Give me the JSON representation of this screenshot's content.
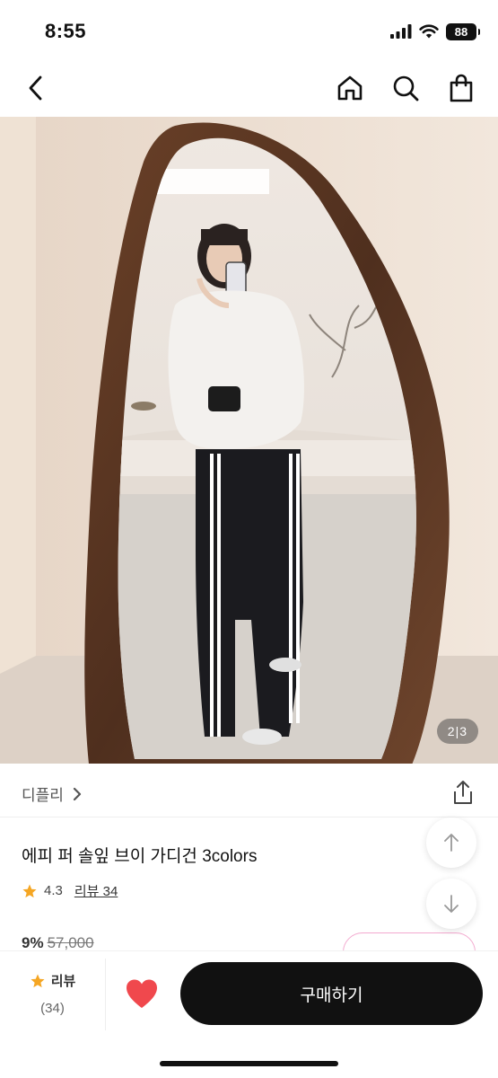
{
  "status": {
    "time": "8:55",
    "battery": "88"
  },
  "nav": {
    "back_icon": "chevron-left-icon",
    "home_icon": "home-icon",
    "search_icon": "search-icon",
    "bag_icon": "shopping-bag-icon"
  },
  "gallery": {
    "counter_current": "2",
    "counter_total": "3",
    "current_index": 2,
    "total": 3
  },
  "seller": {
    "name": "디플리"
  },
  "product": {
    "title": "에피 퍼 솔잎 브이 가디건 3colors",
    "rating": "4.3",
    "review_label": "리뷰 34",
    "discount": "9%",
    "original_price": "57,000"
  },
  "bottom_bar": {
    "review_label": "리뷰",
    "review_count": "(34)",
    "buy_label": "구매하기",
    "heart_color": "#f0484d"
  },
  "colors": {
    "star": "#f5a623",
    "coupon_border": "#f3a9cf",
    "buy_bg": "#111111"
  }
}
